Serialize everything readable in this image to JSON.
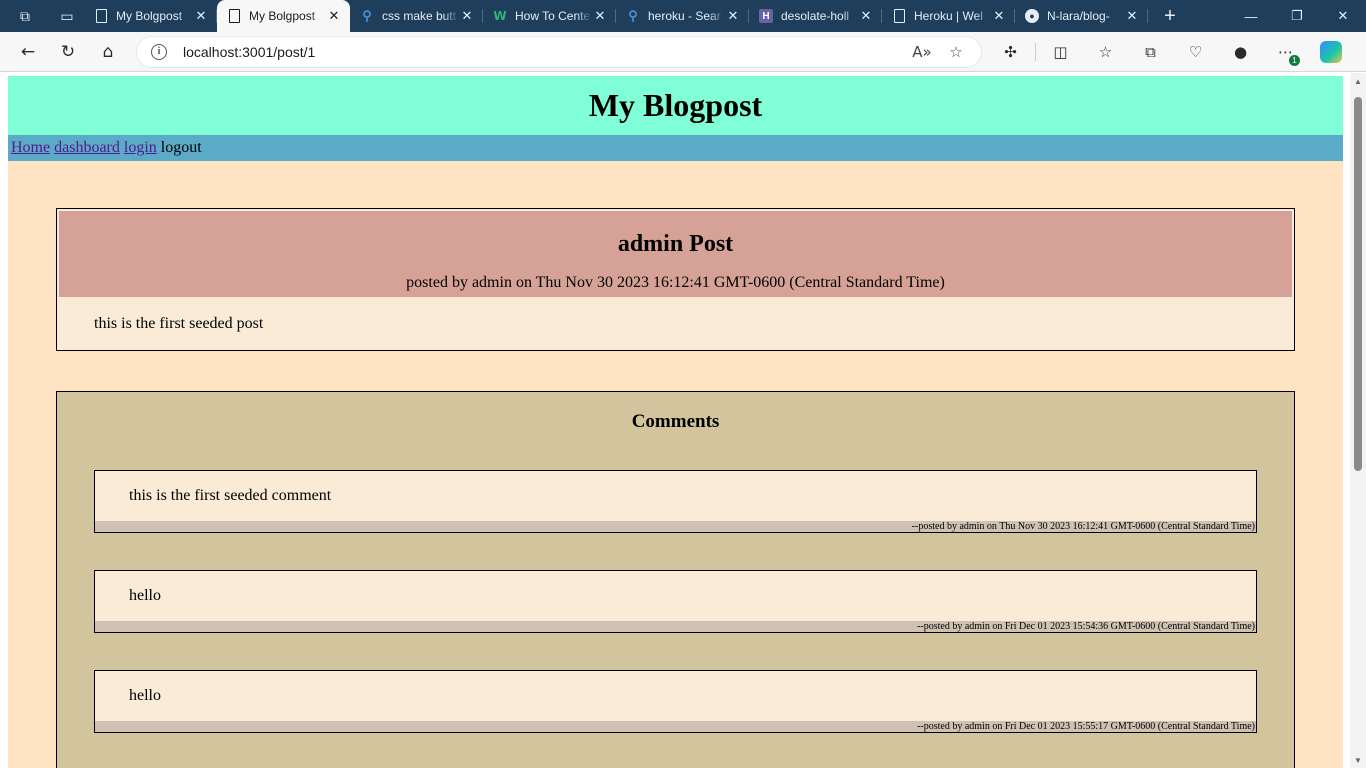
{
  "browser": {
    "tabs": [
      {
        "title": "My Bolgpost",
        "favicon": "page-icon",
        "active": false
      },
      {
        "title": "My Bolgpost",
        "favicon": "page-icon",
        "active": true
      },
      {
        "title": "css make butt",
        "favicon": "search-icon",
        "active": false
      },
      {
        "title": "How To Cente",
        "favicon": "w-icon",
        "active": false
      },
      {
        "title": "heroku - Sear",
        "favicon": "search-icon",
        "active": false
      },
      {
        "title": "desolate-holl",
        "favicon": "heroku-icon",
        "active": false
      },
      {
        "title": "Heroku | Wel",
        "favicon": "page-icon",
        "active": false
      },
      {
        "title": "N-lara/blog-",
        "favicon": "github-icon",
        "active": false
      }
    ],
    "address": "localhost:3001/post/1",
    "extension_badge": "1"
  },
  "site": {
    "title": "My Blogpost",
    "nav": {
      "home": "Home",
      "dashboard": "dashboard",
      "login": "login",
      "logout": "logout"
    },
    "colors": {
      "header_bg": "#80ffd7",
      "nav_bg": "#5aaac8",
      "main_bg": "#ffe4c4",
      "post_head_bg": "#d6a297",
      "comments_bg": "#d2c49c"
    }
  },
  "post": {
    "title": "admin Post",
    "meta": "posted by admin on Thu Nov 30 2023 16:12:41 GMT-0600 (Central Standard Time)",
    "body": "this is the first seeded post"
  },
  "comments": {
    "heading": "Comments",
    "items": [
      {
        "text": "this is the first seeded comment",
        "meta": "--posted by admin on Thu Nov 30 2023 16:12:41 GMT-0600 (Central Standard Time)"
      },
      {
        "text": "hello",
        "meta": "--posted by admin on Fri Dec 01 2023 15:54:36 GMT-0600 (Central Standard Time)"
      },
      {
        "text": "hello",
        "meta": "--posted by admin on Fri Dec 01 2023 15:55:17 GMT-0600 (Central Standard Time)"
      }
    ]
  }
}
